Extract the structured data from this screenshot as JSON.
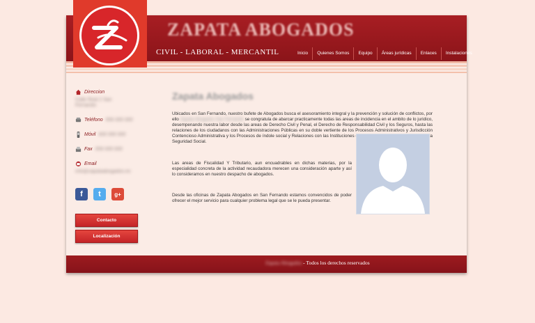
{
  "brand": {
    "name": "ZAPATA ABOGADOS",
    "tagline": "CIVIL - LABORAL - MERCANTIL"
  },
  "nav": {
    "items": [
      {
        "label": "Inicio"
      },
      {
        "label": "Quienes Somos"
      },
      {
        "label": "Equipo"
      },
      {
        "label": "Áreas jurídicas"
      },
      {
        "label": "Enlaces"
      },
      {
        "label": "Instalaciones"
      }
    ]
  },
  "sidebar": {
    "direccion_label": "Direccion",
    "direccion_value": "Calle Real 2 San Fernando",
    "telefono_label": "Teléfono",
    "telefono_value": "956 000 000",
    "movil_label": "Móvil",
    "movil_value": "600 000 000",
    "fax_label": "Fax",
    "fax_value": "956 000 000",
    "email_label": "Email",
    "email_value": "info@zapataabogados.es",
    "contacto_button": "Contacto",
    "localizacion_button": "Localización"
  },
  "social": {
    "facebook": "f",
    "twitter": "t",
    "googleplus": "g+"
  },
  "content": {
    "title": "Zapata Abogados",
    "p1_a": "Ubicados en San Fernando, nuestro bufete de Abogados busca el asesoramiento integral y la prevención y solución de conflictos, por ello",
    "p1_blur": "Zapata Abogados San Fernando",
    "p1_b": "se congratula de abarcar practicamente todas las areas de incidencia en el ambito de lo juridico, desempenando nuestra labor desde las areas de Derecho Civil y Penal, el Derecho de Responsabilidad Civil y los Seguros, hasta las relaciones de los ciudadanos con las Administraciones Públicas en su doble vertiente de los Procesos Administrativos y Jurisdicción Contencioso Administrativa y los Procesos de índole social y Relaciones con las Instituciones de Provisión Pública y Conflictos con la Seguridad Social.",
    "p2": "Las areas de Fiscalidad Y Tributario, aun encuadrables en dichas materias, por la especialidad concreta de la actividad recaudadora merecen una consideración aparte y así lo consideramos en nuestro despacho de abogados.",
    "p3": "Desde las oficinas de Zapata Abogados en San Fernando estamos convencidos de poder ofrecer el mejor servicio para cualquier problema legal que se le pueda presentar."
  },
  "footer": {
    "blur_text": "Zapata Abogados",
    "text": "- Todos los derechos reservados"
  },
  "colors": {
    "primary": "#8f161b",
    "accent": "#e03a2b",
    "background": "#fce9e2"
  }
}
